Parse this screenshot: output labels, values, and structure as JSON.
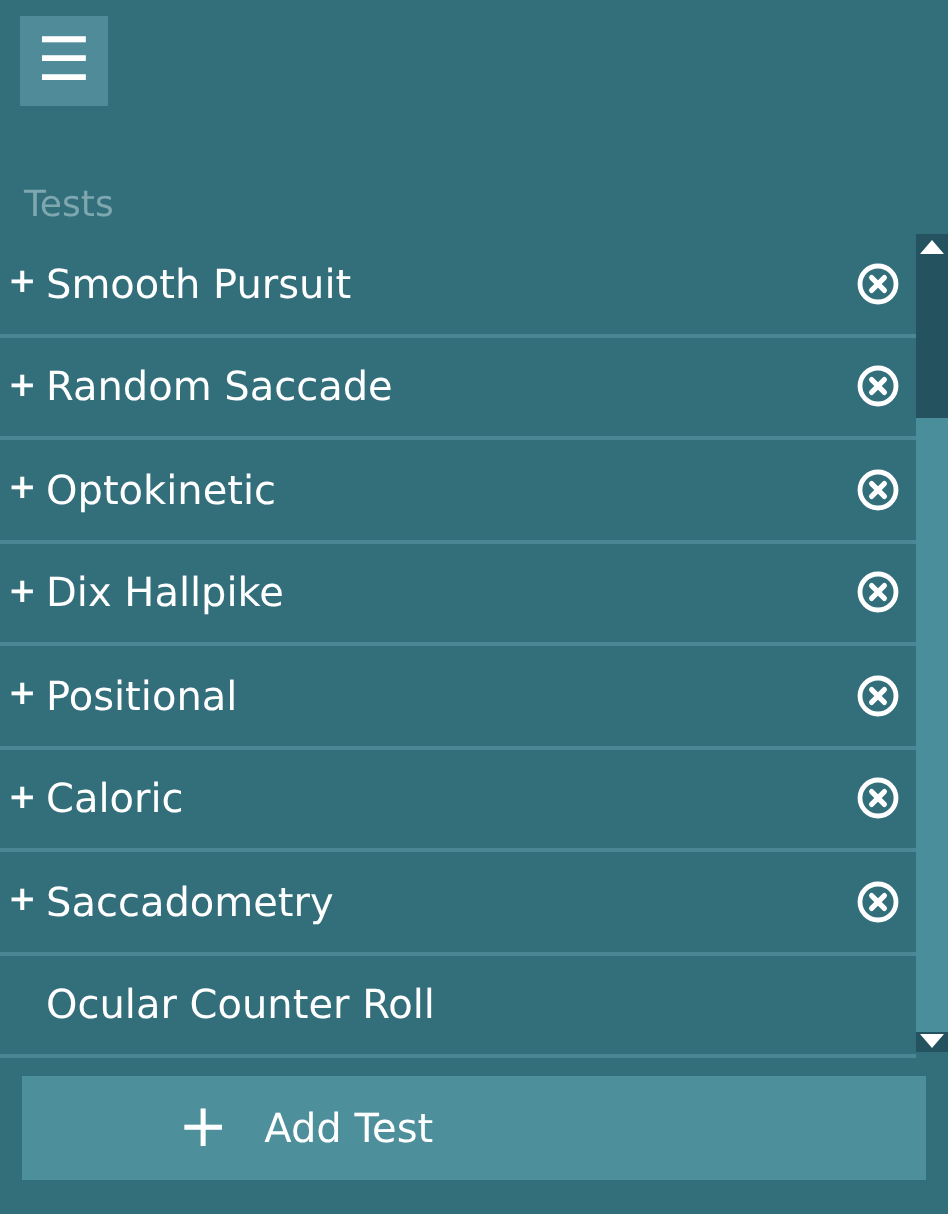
{
  "menu_button": {
    "icon": "☰"
  },
  "section_label": "Tests",
  "tests": [
    {
      "toggle": "+",
      "name": "Smooth Pursuit",
      "removable": true
    },
    {
      "toggle": "+",
      "name": "Random Saccade",
      "removable": true
    },
    {
      "toggle": "+",
      "name": "Optokinetic",
      "removable": true
    },
    {
      "toggle": "+",
      "name": "Dix Hallpike",
      "removable": true
    },
    {
      "toggle": "+",
      "name": "Positional",
      "removable": true
    },
    {
      "toggle": "+",
      "name": "Caloric",
      "removable": true
    },
    {
      "toggle": "+",
      "name": "Saccadometry",
      "removable": true
    },
    {
      "name": "Ocular Counter Roll",
      "removable": false
    }
  ],
  "add_button": {
    "icon": "+",
    "label": "Add Test"
  }
}
